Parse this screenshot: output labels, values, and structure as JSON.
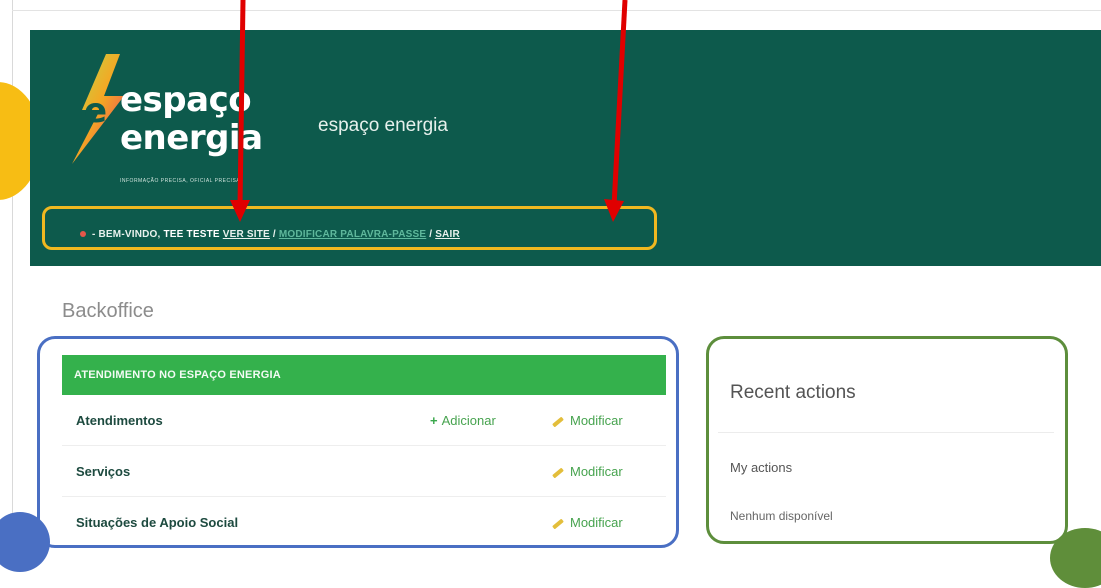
{
  "branding": {
    "logo_line1": "espaço",
    "logo_line2": "energia",
    "tagline": "INFORMAÇÃO PRECISA, OFICIAL PRECISA",
    "site_title": "espaço energia"
  },
  "userbar": {
    "welcome": "- BEM-VINDO,",
    "username": "TEE TESTE",
    "view_site": "VER SITE",
    "separator1": " / ",
    "change_password": "MODIFICAR PALAVRA-PASSE",
    "separator2": " / ",
    "logout": "SAIR"
  },
  "page": {
    "title": "Backoffice"
  },
  "module": {
    "caption": "ATENDIMENTO NO ESPAÇO ENERGIA",
    "rows": [
      {
        "name": "Atendimentos",
        "add": "Adicionar",
        "change": "Modificar"
      },
      {
        "name": "Serviços",
        "add": "",
        "change": "Modificar"
      },
      {
        "name": "Situações de Apoio Social",
        "add": "",
        "change": "Modificar"
      }
    ]
  },
  "recent_actions": {
    "title": "Recent actions",
    "subtitle": "My actions",
    "empty": "Nenhum disponível"
  },
  "colors": {
    "header_bg": "#0d5a4c",
    "module_caption_bg": "#34b14c",
    "annotation_yellow": "#f0b820",
    "annotation_blue": "#4a6fc3",
    "annotation_green": "#5d8e3c",
    "annotation_arrow": "#e00000"
  }
}
